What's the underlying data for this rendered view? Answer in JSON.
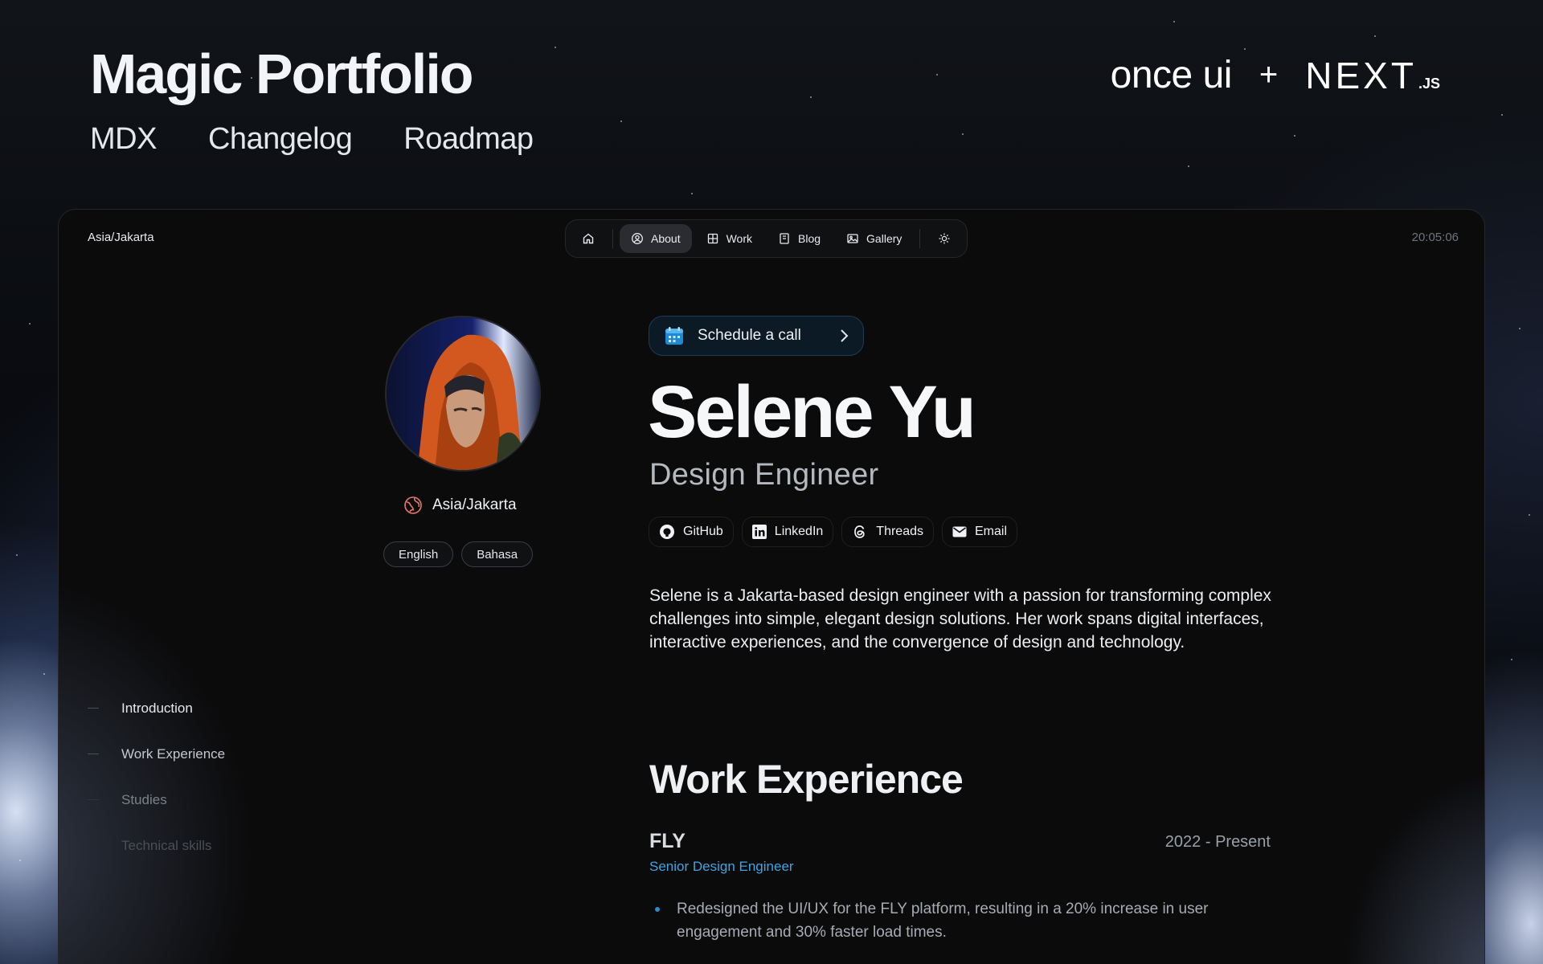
{
  "header": {
    "title": "Magic Portfolio",
    "links": [
      "MDX",
      "Changelog",
      "Roadmap"
    ],
    "logos": {
      "once_ui": "once ui",
      "plus": "+",
      "nextjs": "NEXT",
      "nextjs_suffix": ".JS"
    }
  },
  "topbar": {
    "location": "Asia/Jakarta",
    "time": "20:05:06",
    "nav": {
      "home_icon": "home-icon",
      "about": "About",
      "work": "Work",
      "blog": "Blog",
      "gallery": "Gallery",
      "theme_icon": "sun-icon"
    }
  },
  "profile": {
    "location": "Asia/Jakarta",
    "languages": [
      "English",
      "Bahasa"
    ]
  },
  "toc": [
    {
      "label": "Introduction",
      "color": "#e6e8ec"
    },
    {
      "label": "Work Experience",
      "color": "#c4c8ce"
    },
    {
      "label": "Studies",
      "color": "#7c8188"
    },
    {
      "label": "Technical skills",
      "color": "#4a4e55"
    }
  ],
  "main": {
    "schedule_label": "Schedule a call",
    "name": "Selene Yu",
    "role": "Design Engineer",
    "socials": [
      "GitHub",
      "LinkedIn",
      "Threads",
      "Email"
    ],
    "intro": "Selene is a Jakarta-based design engineer with a passion for transforming complex challenges into simple, elegant design solutions. Her work spans digital interfaces, interactive experiences, and the convergence of design and technology.",
    "work_title": "Work Experience",
    "jobs": [
      {
        "company": "FLY",
        "dates": "2022 - Present",
        "role": "Senior Design Engineer",
        "bullets": [
          "Redesigned the UI/UX for the FLY platform, resulting in a 20% increase in user engagement and 30% faster load times."
        ]
      }
    ]
  },
  "colors": {
    "accent": "#3fa4e4",
    "background": "#0b0b0c",
    "location_icon": "#e8776a"
  }
}
